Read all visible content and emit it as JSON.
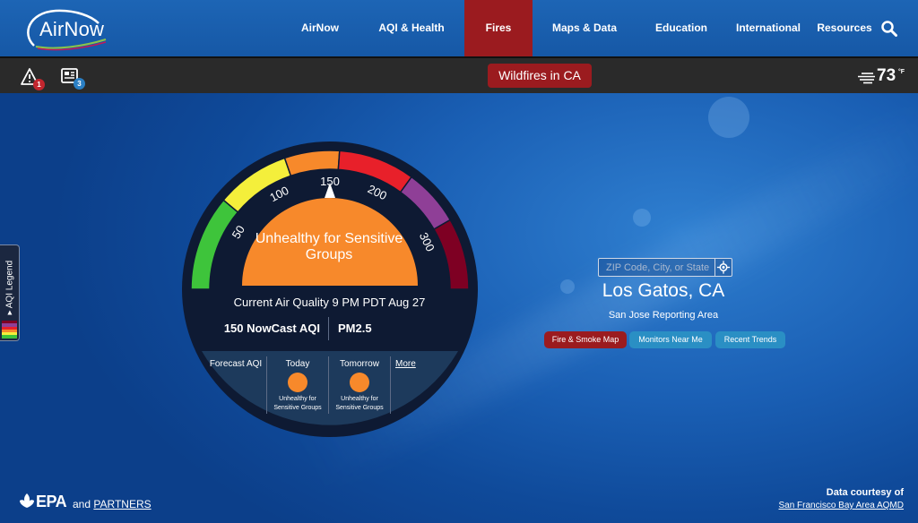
{
  "brand": {
    "name": "AirNow"
  },
  "nav": {
    "items": [
      {
        "label": "AirNow"
      },
      {
        "label": "AQI & Health"
      },
      {
        "label": "Fires"
      },
      {
        "label": "Maps & Data"
      },
      {
        "label": "Education"
      },
      {
        "label": "International"
      },
      {
        "label": "Resources"
      }
    ],
    "active": "Fires"
  },
  "subbar": {
    "alerts_count": "1",
    "news_count": "3",
    "wildfires_label": "Wildfires in CA",
    "temperature": "73",
    "temperature_unit": "°F"
  },
  "legend_tab": {
    "label": "AQI Legend"
  },
  "gauge": {
    "value": 150,
    "max_scale": 300,
    "ticks": [
      "50",
      "100",
      "150",
      "200",
      "300"
    ],
    "category": "Unhealthy for Sensitive Groups",
    "current_label": "Current Air Quality 9 PM PDT Aug 27",
    "nowcast_label": "150 NowCast AQI",
    "pollutant": "PM2.5",
    "colors": {
      "good": "#3ec43b",
      "moderate": "#f4ef3b",
      "usg": "#f7892b",
      "unhealthy": "#e8202a",
      "very_unhealthy": "#8f3f97",
      "hazardous": "#7e0023"
    }
  },
  "forecast": {
    "label": "Forecast AQI",
    "days": [
      {
        "day": "Today",
        "category": "Unhealthy for Sensitive Groups",
        "color": "#f7892b"
      },
      {
        "day": "Tomorrow",
        "category": "Unhealthy for Sensitive Groups",
        "color": "#f7892b"
      }
    ],
    "more_label": "More"
  },
  "location": {
    "placeholder": "ZIP Code, City, or State",
    "city": "Los Gatos, CA",
    "reporting_area": "San Jose Reporting Area",
    "buttons": [
      {
        "label": "Fire & Smoke Map",
        "color": "#9b1b1f"
      },
      {
        "label": "Monitors Near Me",
        "color": "#2a8fc4"
      },
      {
        "label": "Recent Trends",
        "color": "#2a8fc4"
      }
    ]
  },
  "footer": {
    "epa_label": "EPA",
    "and_label": "and",
    "partners_label": "PARTNERS",
    "courtesy_label": "Data courtesy of",
    "courtesy_source": "San Francisco Bay Area AQMD"
  }
}
